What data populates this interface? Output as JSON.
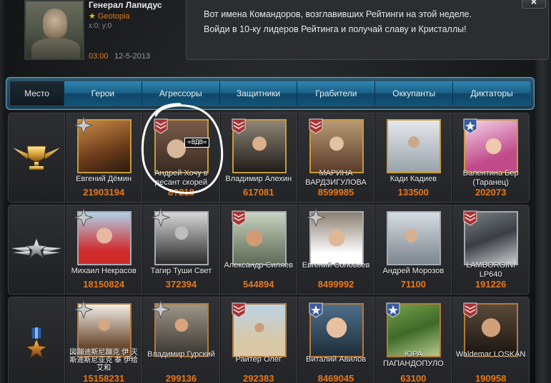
{
  "header": {
    "player_name": "Генерал Лапидус",
    "alliance": "Geotopia",
    "coords": "x:0; y:0",
    "time": "03:00",
    "date": "12-5-2013",
    "info_line1": "Вот имена Командоров, возглавивших Рейтинги на этой неделе.",
    "info_line2": "Войди в 10-ку лидеров Рейтинга и получай славу и Кристаллы!",
    "close_label": "×"
  },
  "tabs": [
    "Место",
    "Герои",
    "Агрессоры",
    "Защитники",
    "Грабители",
    "Оккупанты",
    "Диктаторы"
  ],
  "vdv_tag": "=ВДВ=",
  "rows": [
    {
      "rank": "gold",
      "players": [
        {
          "name": "Евгений Дёмин",
          "score": "21903194"
        },
        {
          "name": "Андрей Хочу в десант скорей",
          "score": "8?218"
        },
        {
          "name": "Владимир Алехин",
          "score": "617081"
        },
        {
          "name": "МАРИНА ВАРДЗИГУЛОВА",
          "score": "8599985"
        },
        {
          "name": "Кади Кадиев",
          "score": "133500"
        },
        {
          "name": "Валентина Бер (Таранец)",
          "score": "202073"
        }
      ]
    },
    {
      "rank": "silver",
      "players": [
        {
          "name": "Михаил Некрасов",
          "score": "18150824"
        },
        {
          "name": "Тагир Туши Свет",
          "score": "372394"
        },
        {
          "name": "Александр Силяев",
          "score": "544894"
        },
        {
          "name": "Евгений Соловьев",
          "score": "8499992"
        },
        {
          "name": "Андрей Морозов",
          "score": "71100"
        },
        {
          "name": "LAMBORGINI LP640",
          "score": "191226"
        }
      ]
    },
    {
      "rank": "bronze",
      "players": [
        {
          "name": "図蹦迪斯尼蹦克 伊 灭斯迪斯尼亚克 泰 伊给艾和",
          "score": "15158231"
        },
        {
          "name": "Владимир Гурский",
          "score": "299136"
        },
        {
          "name": "Райтер Олег",
          "score": "292383"
        },
        {
          "name": "Виталий Авилов",
          "score": "8469045"
        },
        {
          "name": "ЮРА ПАПАНДОПУЛО",
          "score": "63100"
        },
        {
          "name": "Waldemar LOSKAN",
          "score": "190958"
        }
      ]
    }
  ],
  "colors": {
    "accent_orange": "#e8781c",
    "tab_blue": "#1a5f86",
    "gold_border": "#c89a3e"
  }
}
